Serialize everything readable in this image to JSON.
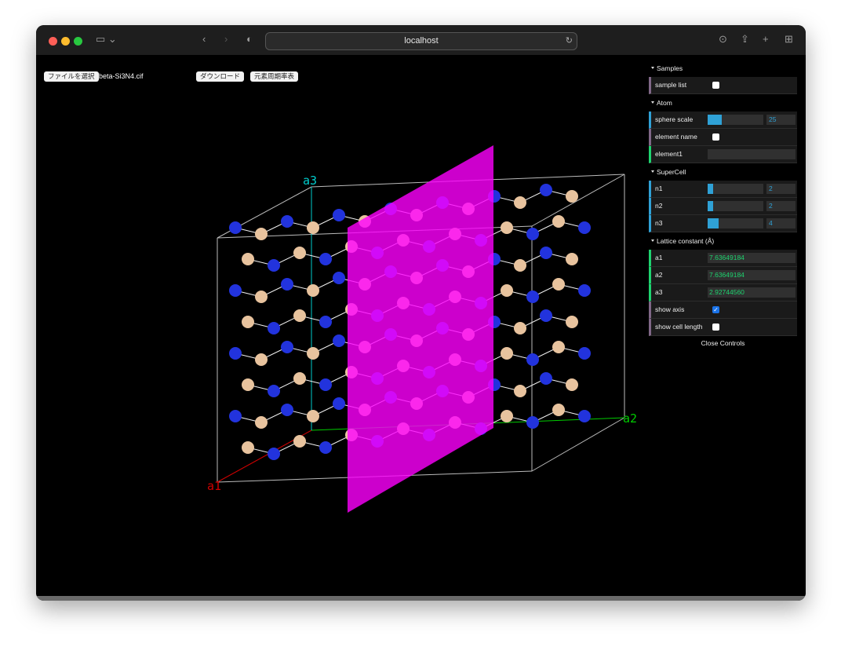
{
  "browser": {
    "url": "localhost"
  },
  "toolbar": {
    "choose_file": "ファイルを選択",
    "file_name": "beta-Si3N4.cif",
    "download": "ダウンロード",
    "periodic_table": "元素周期率表"
  },
  "axes": {
    "a1": "a1",
    "a2": "a2",
    "a3": "a3"
  },
  "colors": {
    "si": "#e8c39e",
    "n": "#2233dd",
    "plane": "#ff00ff",
    "a1": "#d00000",
    "a2": "#00cc00",
    "a3": "#00cccc"
  },
  "controls": {
    "samples": {
      "title": "Samples",
      "sample_list": "sample list",
      "sample_list_checked": false
    },
    "atom": {
      "title": "Atom",
      "sphere_scale_label": "sphere scale",
      "sphere_scale": "25",
      "sphere_scale_fraction": 0.25,
      "element_name_label": "element name",
      "element_name_checked": false,
      "element1_label": "element1",
      "element1": ""
    },
    "supercell": {
      "title": "SuperCell",
      "n1_label": "n1",
      "n1": "2",
      "n2_label": "n2",
      "n2": "2",
      "n3_label": "n3",
      "n3": "4"
    },
    "lattice": {
      "title": "Lattice constant (Å)",
      "a1_label": "a1",
      "a1": "7.63649184",
      "a2_label": "a2",
      "a2": "7.63649184",
      "a3_label": "a3",
      "a3": "2.92744560",
      "show_axis_label": "show axis",
      "show_axis_checked": true,
      "show_cell_length_label": "show cell length",
      "show_cell_length_checked": false
    },
    "close": "Close Controls"
  }
}
